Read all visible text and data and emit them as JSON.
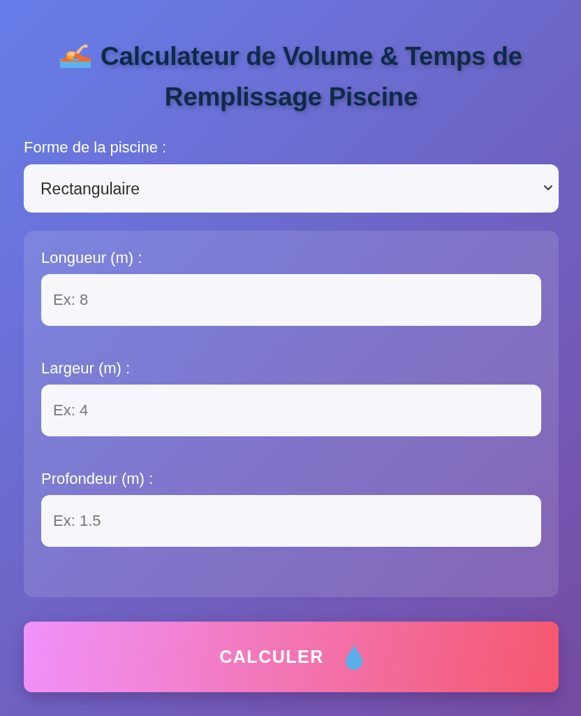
{
  "title": "Calculateur de Volume & Temps de Remplissage Piscine",
  "shape": {
    "label": "Forme de la piscine :",
    "value": "Rectangulaire"
  },
  "fields": [
    {
      "label": "Longueur (m) :",
      "placeholder": "Ex: 8"
    },
    {
      "label": "Largeur (m) :",
      "placeholder": "Ex: 4"
    },
    {
      "label": "Profondeur (m) :",
      "placeholder": "Ex: 1.5"
    }
  ],
  "button": {
    "label": "CALCULER"
  }
}
